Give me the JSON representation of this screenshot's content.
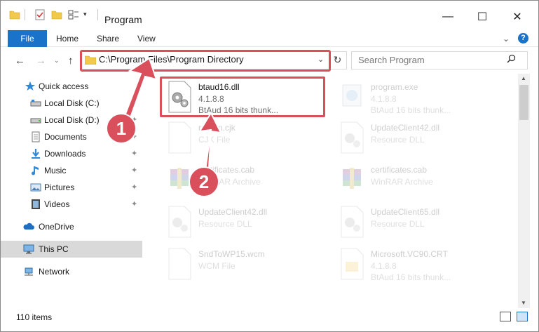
{
  "window": {
    "title": "Program",
    "controls": {
      "minimize": "—",
      "maximize": "☐",
      "close": "✕"
    }
  },
  "ribbon": {
    "tabs": [
      "File",
      "Home",
      "Share",
      "View"
    ],
    "help": "?",
    "chevron": "⌄"
  },
  "nav": {
    "back": "←",
    "forward": "→",
    "recent": "⌄",
    "up": "↑",
    "address": "C:\\Program Files\\Program Directory",
    "address_dropdown": "⌄",
    "refresh": "↻",
    "search_placeholder": "Search Program"
  },
  "sidebar": {
    "items": [
      {
        "label": "Quick access",
        "icon": "star-icon",
        "pinned": false
      },
      {
        "label": "Local Disk (C:)",
        "icon": "drive-icon",
        "pinned": true
      },
      {
        "label": "Local Disk (D:)",
        "icon": "drive-icon",
        "pinned": true
      },
      {
        "label": "Documents",
        "icon": "documents-icon",
        "pinned": true
      },
      {
        "label": "Downloads",
        "icon": "downloads-icon",
        "pinned": true
      },
      {
        "label": "Music",
        "icon": "music-icon",
        "pinned": true
      },
      {
        "label": "Pictures",
        "icon": "pictures-icon",
        "pinned": true
      },
      {
        "label": "Videos",
        "icon": "videos-icon",
        "pinned": true
      },
      {
        "label": "OneDrive",
        "icon": "onedrive-icon",
        "pinned": false
      },
      {
        "label": "This PC",
        "icon": "this-pc-icon",
        "pinned": false
      },
      {
        "label": "Network",
        "icon": "network-icon",
        "pinned": false
      }
    ],
    "pin_glyph": "📌"
  },
  "files": [
    {
      "name": "btaud16.dll",
      "line1": "4.1.8.8",
      "line2": "BtAud 16 bits thunk...",
      "icon": "dll-gear-icon",
      "highlighted": true
    },
    {
      "name": "program.exe",
      "line1": "4.1.8.8",
      "line2": "BtAud 16 bits thunk...",
      "icon": "exe-icon",
      "highlighted": false
    },
    {
      "name": "rrenan.cjk",
      "line1": "CJK File",
      "line2": "",
      "icon": "blank-file-icon",
      "highlighted": false
    },
    {
      "name": "UpdateClient42.dll",
      "line1": "Resource DLL",
      "line2": "",
      "icon": "dll-gear-icon",
      "highlighted": false
    },
    {
      "name": "certificates.cab",
      "line1": "WinRAR Archive",
      "line2": "",
      "icon": "winrar-icon",
      "highlighted": false
    },
    {
      "name": "certificates.cab",
      "line1": "WinRAR Archive",
      "line2": "",
      "icon": "winrar-icon",
      "highlighted": false
    },
    {
      "name": "UpdateClient42.dll",
      "line1": "Resource DLL",
      "line2": "",
      "icon": "dll-gear-icon",
      "highlighted": false
    },
    {
      "name": "UpdateClient65.dll",
      "line1": "Resource DLL",
      "line2": "",
      "icon": "dll-gear-icon",
      "highlighted": false
    },
    {
      "name": "SndToWP15.wcm",
      "line1": "WCM File",
      "line2": "",
      "icon": "blank-file-icon",
      "highlighted": false
    },
    {
      "name": "Microsoft.VC90.CRT",
      "line1": "4.1.8.8",
      "line2": "BtAud 16 bits thunk...",
      "icon": "folder-file-icon",
      "highlighted": false
    }
  ],
  "status": {
    "items": "110 items"
  },
  "callouts": [
    "1",
    "2"
  ],
  "colors": {
    "accent": "#1a73c8",
    "callout": "#d94f5c",
    "selection": "#cce8ff"
  }
}
